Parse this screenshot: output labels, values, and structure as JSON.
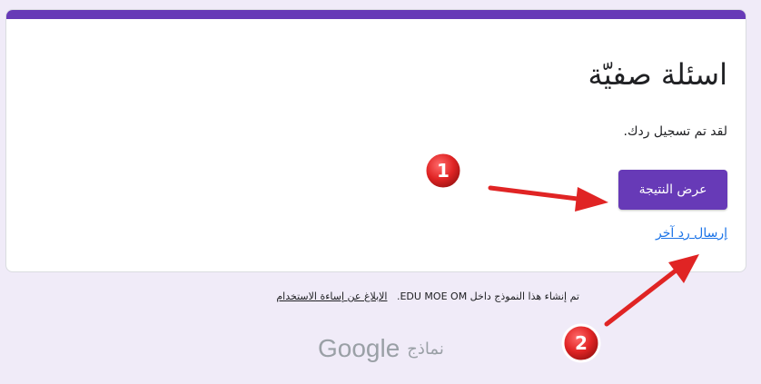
{
  "form": {
    "title": "اسئلة صفيّة",
    "confirmation": "لقد تم تسجيل ردك.",
    "view_result_label": "عرض النتيجة",
    "submit_another_label": "إرسال رد آخر"
  },
  "footer": {
    "created_in": "تم إنشاء هذا النموذج داخل EDU MOE OM.",
    "report_abuse": "الإبلاغ عن إساءة الاستخدام"
  },
  "brand": {
    "forms_word": "نماذج",
    "google_word": "Google"
  },
  "annotations": [
    {
      "label": "1"
    },
    {
      "label": "2"
    }
  ],
  "colors": {
    "accent": "#673ab7",
    "link": "#1a73e8",
    "annotation": "#e02424"
  }
}
